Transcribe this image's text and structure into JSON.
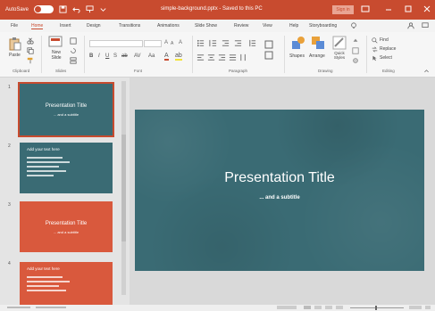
{
  "titlebar": {
    "autosave": "AutoSave",
    "doc_title": "simple-background.pptx - Saved to this PC",
    "sign_in": "Sign in"
  },
  "tabs": [
    "File",
    "Home",
    "Insert",
    "Design",
    "Transitions",
    "Animations",
    "Slide Show",
    "Review",
    "View",
    "Help",
    "Storyboarding"
  ],
  "active_tab": "Home",
  "ribbon": {
    "groups": [
      "Clipboard",
      "Slides",
      "Font",
      "Paragraph",
      "Drawing",
      "Editing"
    ],
    "buttons": {
      "paste": "Paste",
      "new_slide": "New Slide",
      "shapes": "Shapes",
      "arrange": "Arrange",
      "quick_styles": "Quick Styles",
      "find": "Find",
      "replace": "Replace",
      "select": "Select"
    }
  },
  "thumbnails": [
    {
      "num": "1",
      "title": "Presentation Title",
      "subtitle": "... and a subtitle"
    },
    {
      "num": "2",
      "heading": "Add your text here"
    },
    {
      "num": "3",
      "title": "Presentation Title",
      "subtitle": "... and a subtitle"
    },
    {
      "num": "4",
      "heading": "Add your text here"
    }
  ],
  "main_slide": {
    "title": "Presentation Title",
    "subtitle": "... and a subtitle"
  },
  "colors": {
    "accent": "#c84b2f",
    "teal": "#3a6b74",
    "orange_slide": "#d9593d"
  }
}
